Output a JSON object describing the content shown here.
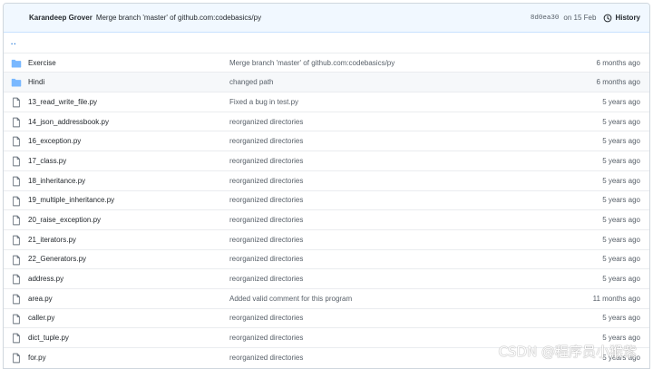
{
  "commit_bar": {
    "author": "Karandeep Grover",
    "message": "Merge branch 'master' of github.com:codebasics/py",
    "sha": "8d0ea30",
    "date": "on 15 Feb",
    "history_label": "History"
  },
  "parent_dir": "..",
  "files": [
    {
      "type": "dir",
      "name": "Exercise",
      "message": "Merge branch 'master' of github.com:codebasics/py",
      "age": "6 months ago"
    },
    {
      "type": "dir",
      "name": "Hindi",
      "message": "changed path",
      "age": "6 months ago"
    },
    {
      "type": "file",
      "name": "13_read_write_file.py",
      "message": "Fixed a bug in test.py",
      "age": "5 years ago"
    },
    {
      "type": "file",
      "name": "14_json_addressbook.py",
      "message": "reorganized directories",
      "age": "5 years ago"
    },
    {
      "type": "file",
      "name": "16_exception.py",
      "message": "reorganized directories",
      "age": "5 years ago"
    },
    {
      "type": "file",
      "name": "17_class.py",
      "message": "reorganized directories",
      "age": "5 years ago"
    },
    {
      "type": "file",
      "name": "18_inheritance.py",
      "message": "reorganized directories",
      "age": "5 years ago"
    },
    {
      "type": "file",
      "name": "19_multiple_inheritance.py",
      "message": "reorganized directories",
      "age": "5 years ago"
    },
    {
      "type": "file",
      "name": "20_raise_exception.py",
      "message": "reorganized directories",
      "age": "5 years ago"
    },
    {
      "type": "file",
      "name": "21_iterators.py",
      "message": "reorganized directories",
      "age": "5 years ago"
    },
    {
      "type": "file",
      "name": "22_Generators.py",
      "message": "reorganized directories",
      "age": "5 years ago"
    },
    {
      "type": "file",
      "name": "address.py",
      "message": "reorganized directories",
      "age": "5 years ago"
    },
    {
      "type": "file",
      "name": "area.py",
      "message": "Added valid comment for this program",
      "age": "11 months ago"
    },
    {
      "type": "file",
      "name": "caller.py",
      "message": "reorganized directories",
      "age": "5 years ago"
    },
    {
      "type": "file",
      "name": "dict_tuple.py",
      "message": "reorganized directories",
      "age": "5 years ago"
    },
    {
      "type": "file",
      "name": "for.py",
      "message": "reorganized directories",
      "age": "5 years ago"
    }
  ],
  "watermark": "CSDN @程序员小猴紫",
  "colors": {
    "folder": "#79b8ff",
    "link": "#0366d6",
    "muted": "#586069"
  }
}
